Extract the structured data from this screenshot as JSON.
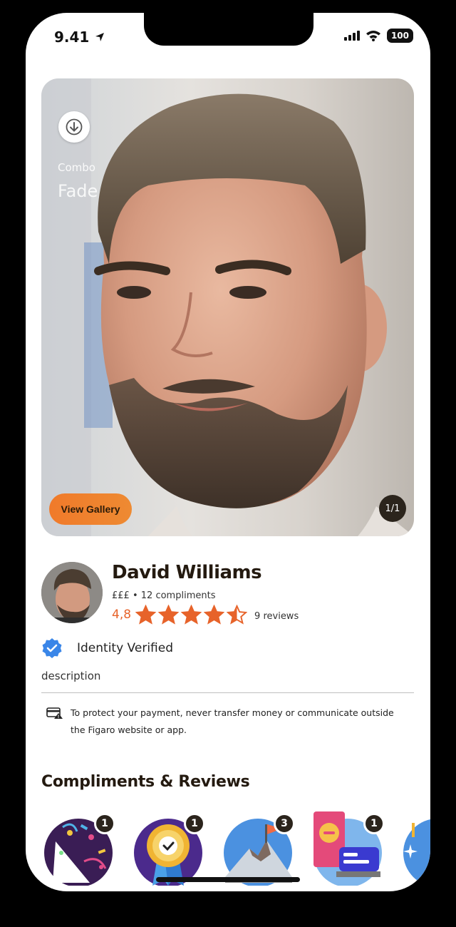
{
  "status": {
    "time": "9.41",
    "battery": "100"
  },
  "hero": {
    "style_category": "Combo",
    "style_name": "Fade",
    "view_gallery_label": "View Gallery",
    "image_counter": "1/1"
  },
  "profile": {
    "name": "David Williams",
    "price_level": "£££",
    "compliments": "12 compliments",
    "rating": "4,8",
    "rating_value": 4.8,
    "reviews": "9 reviews",
    "verified_label": "Identity Verified",
    "description": "description"
  },
  "notice": {
    "text": "To protect your payment, never transfer money or communicate outside the Figaro website or app."
  },
  "section": {
    "title": "Compliments & Reviews"
  },
  "badges": [
    {
      "count": "1",
      "icon": "party-icon"
    },
    {
      "count": "1",
      "icon": "medal-icon"
    },
    {
      "count": "3",
      "icon": "mountain-flag-icon"
    },
    {
      "count": "1",
      "icon": "grooming-products-icon"
    }
  ],
  "colors": {
    "accent": "#e7632a",
    "dark": "#2b241c",
    "verified": "#3a86e8"
  }
}
